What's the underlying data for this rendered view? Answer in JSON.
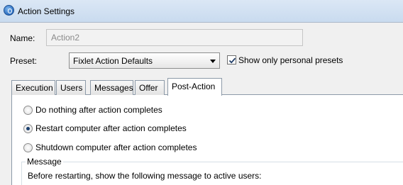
{
  "window": {
    "title": "Action Settings",
    "icon": "bigfix-app-icon"
  },
  "form": {
    "name_label": "Name:",
    "name_value": "Action2",
    "preset_label": "Preset:",
    "preset_selected": "Fixlet Action Defaults",
    "personal_presets_label": "Show only personal presets",
    "personal_presets_checked": true
  },
  "tabs": [
    {
      "label": "Execution",
      "active": false
    },
    {
      "label": "Users",
      "active": false
    },
    {
      "label": "Messages",
      "active": false
    },
    {
      "label": "Offer",
      "active": false
    },
    {
      "label": "Post-Action",
      "active": true
    }
  ],
  "post_action": {
    "options": [
      {
        "label": "Do nothing after action completes",
        "selected": false
      },
      {
        "label": "Restart computer after action completes",
        "selected": true
      },
      {
        "label": "Shutdown computer after action completes",
        "selected": false
      }
    ],
    "message_group": {
      "legend": "Message",
      "text": "Before restarting, show the following message to active users:"
    }
  }
}
